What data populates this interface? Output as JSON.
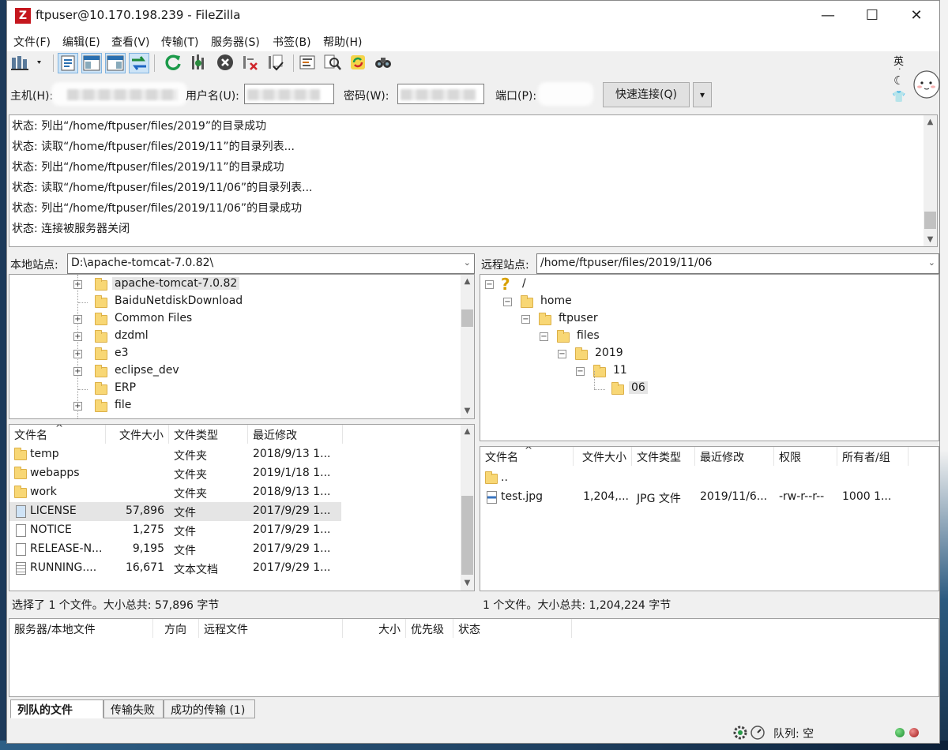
{
  "window": {
    "title": "ftpuser@10.170.198.239 - FileZilla",
    "app_icon": "Z",
    "minimize": "—",
    "maximize": "☐",
    "close": "✕"
  },
  "menu": [
    "文件(F)",
    "编辑(E)",
    "查看(V)",
    "传输(T)",
    "服务器(S)",
    "书签(B)",
    "帮助(H)"
  ],
  "toolbar_icons": [
    "site-manager-icon",
    "toggle-log-icon",
    "toggle-local-tree-icon",
    "toggle-remote-tree-icon",
    "toggle-queue-icon",
    "refresh-icon",
    "process-queue-icon",
    "cancel-icon",
    "disconnect-icon",
    "reconnect-icon",
    "filter-icon",
    "compare-icon",
    "sync-browse-icon",
    "search-icon"
  ],
  "quickconnect": {
    "host_label": "主机(H):",
    "user_label": "用户名(U):",
    "password_label": "密码(W):",
    "port_label": "端口(P):",
    "connect_button": "快速连接(Q)",
    "dropdown": "▾"
  },
  "ime": {
    "lang": "英",
    "dot": "·",
    "moon": "☾",
    "shirt": "👕"
  },
  "log": [
    "状态: 列出“/home/ftpuser/files/2019”的目录成功",
    "状态: 读取“/home/ftpuser/files/2019/11”的目录列表...",
    "状态: 列出“/home/ftpuser/files/2019/11”的目录成功",
    "状态: 读取“/home/ftpuser/files/2019/11/06”的目录列表...",
    "状态: 列出“/home/ftpuser/files/2019/11/06”的目录成功",
    "状态: 连接被服务器关闭"
  ],
  "local": {
    "site_label": "本地站点:",
    "path": "D:\\apache-tomcat-7.0.82\\",
    "tree": [
      {
        "name": "apache-tomcat-7.0.82",
        "expandable": true,
        "selected": true
      },
      {
        "name": "BaiduNetdiskDownload",
        "expandable": false,
        "selected": false
      },
      {
        "name": "Common Files",
        "expandable": true,
        "selected": false
      },
      {
        "name": "dzdml",
        "expandable": true,
        "selected": false
      },
      {
        "name": "e3",
        "expandable": true,
        "selected": false
      },
      {
        "name": "eclipse_dev",
        "expandable": true,
        "selected": false
      },
      {
        "name": "ERP",
        "expandable": false,
        "selected": false
      },
      {
        "name": "file",
        "expandable": true,
        "selected": false
      }
    ],
    "columns": [
      "文件名",
      "文件大小",
      "文件类型",
      "最近修改"
    ],
    "files": [
      {
        "name": "temp",
        "size": "",
        "type": "文件夹",
        "modified": "2018/9/13 1...",
        "icon": "folder",
        "selected": false
      },
      {
        "name": "webapps",
        "size": "",
        "type": "文件夹",
        "modified": "2019/1/18 1...",
        "icon": "folder",
        "selected": false
      },
      {
        "name": "work",
        "size": "",
        "type": "文件夹",
        "modified": "2018/9/13 1...",
        "icon": "folder",
        "selected": false
      },
      {
        "name": "LICENSE",
        "size": "57,896",
        "type": "文件",
        "modified": "2017/9/29 1...",
        "icon": "file",
        "selected": true
      },
      {
        "name": "NOTICE",
        "size": "1,275",
        "type": "文件",
        "modified": "2017/9/29 1...",
        "icon": "file",
        "selected": false
      },
      {
        "name": "RELEASE-N...",
        "size": "9,195",
        "type": "文件",
        "modified": "2017/9/29 1...",
        "icon": "file",
        "selected": false
      },
      {
        "name": "RUNNING....",
        "size": "16,671",
        "type": "文本文档",
        "modified": "2017/9/29 1...",
        "icon": "text",
        "selected": false
      }
    ],
    "status": "选择了 1 个文件。大小总共: 57,896 字节"
  },
  "remote": {
    "site_label": "远程站点:",
    "path": "/home/ftpuser/files/2019/11/06",
    "tree": [
      {
        "name": "/",
        "level": 0,
        "icon": "question"
      },
      {
        "name": "home",
        "level": 1,
        "icon": "folder"
      },
      {
        "name": "ftpuser",
        "level": 2,
        "icon": "folder"
      },
      {
        "name": "files",
        "level": 3,
        "icon": "folder"
      },
      {
        "name": "2019",
        "level": 4,
        "icon": "folder"
      },
      {
        "name": "11",
        "level": 5,
        "icon": "folder"
      },
      {
        "name": "06",
        "level": 6,
        "icon": "folder"
      }
    ],
    "question_glyph": "?",
    "columns": [
      "文件名",
      "文件大小",
      "文件类型",
      "最近修改",
      "权限",
      "所有者/组"
    ],
    "files": [
      {
        "name": "..",
        "size": "",
        "type": "",
        "modified": "",
        "perm": "",
        "owner": "",
        "icon": "folder"
      },
      {
        "name": "test.jpg",
        "size": "1,204,...",
        "type": "JPG 文件",
        "modified": "2019/11/6...",
        "perm": "-rw-r--r--",
        "owner": "1000 1...",
        "icon": "image"
      }
    ],
    "status": "1 个文件。大小总共: 1,204,224 字节"
  },
  "queue": {
    "columns": [
      "服务器/本地文件",
      "方向",
      "远程文件",
      "大小",
      "优先级",
      "状态"
    ],
    "tabs": [
      "列队的文件",
      "传输失败",
      "成功的传输 (1)"
    ],
    "status_text": "队列: 空"
  },
  "scroll": {
    "up": "▲",
    "down": "▼",
    "left": "◀",
    "right": "▶"
  },
  "misc": {
    "sort_caret": "^",
    "expand": "+",
    "collapse": "−"
  }
}
